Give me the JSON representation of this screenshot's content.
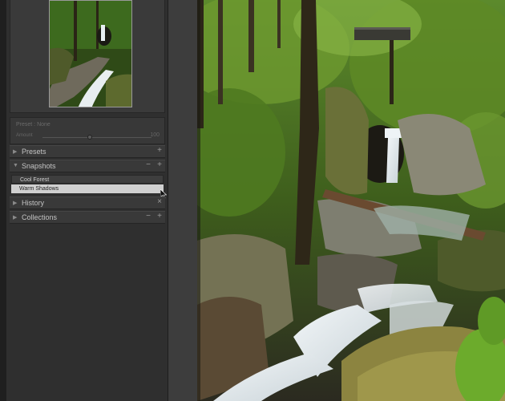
{
  "left_panel": {
    "preset_row": {
      "label": "Preset : None",
      "amount_label": "Amount",
      "amount_value": "100"
    },
    "sections": {
      "presets": {
        "label": "Presets",
        "add_symbol": "+"
      },
      "snapshots": {
        "label": "Snapshots",
        "remove_symbol": "−",
        "add_symbol": "+",
        "items": [
          "Cool Forest",
          "Warm Shadows"
        ],
        "selected_item": "Warm Shadows"
      },
      "history": {
        "label": "History",
        "clear_symbol": "×"
      },
      "collections": {
        "label": "Collections",
        "remove_symbol": "−",
        "add_symbol": "+"
      }
    }
  },
  "colors": {
    "panel_bg": "#2f2f2f",
    "section_bg": "#393939",
    "selected_item_bg": "#d0d0d0",
    "photo_foliage": "#5a8a2a"
  },
  "icons": [
    "triangle-right-icon",
    "triangle-down-icon",
    "plus-icon",
    "minus-icon",
    "close-icon",
    "mouse-pointer-icon"
  ]
}
